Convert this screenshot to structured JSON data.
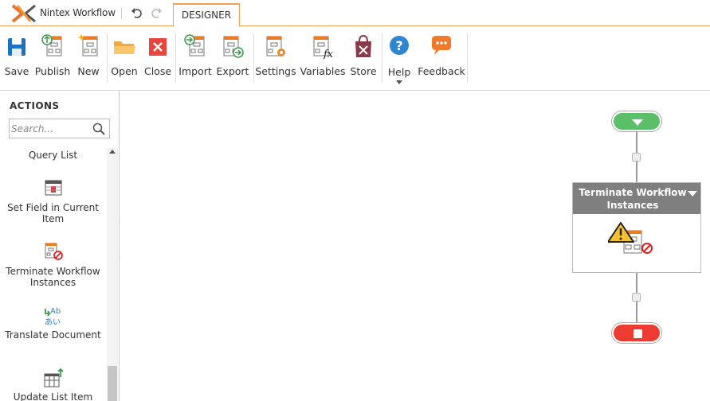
{
  "titlebar": {
    "brand": "Nintex Workflow",
    "tab_designer": "DESIGNER"
  },
  "ribbon": {
    "buttons": [
      {
        "label": "Save",
        "icon": "save-icon"
      },
      {
        "label": "Publish",
        "icon": "publish-icon"
      },
      {
        "label": "New",
        "icon": "new-icon"
      },
      {
        "label": "Open",
        "icon": "folder-icon"
      },
      {
        "label": "Close",
        "icon": "close-icon"
      },
      {
        "label": "Import",
        "icon": "import-icon"
      },
      {
        "label": "Export",
        "icon": "export-icon"
      },
      {
        "label": "Settings",
        "icon": "settings-icon"
      },
      {
        "label": "Variables",
        "icon": "variables-icon"
      },
      {
        "label": "Store",
        "icon": "store-icon"
      },
      {
        "label": "Help",
        "icon": "help-icon"
      },
      {
        "label": "Feedback",
        "icon": "feedback-icon"
      }
    ]
  },
  "actions": {
    "title": "ACTIONS",
    "search_placeholder": "Search...",
    "items": [
      {
        "label": "Query List"
      },
      {
        "label": "Set Field in Current Item"
      },
      {
        "label": "Terminate Workflow Instances"
      },
      {
        "label": "Translate Document"
      },
      {
        "label": "Update List Item"
      }
    ]
  },
  "canvas": {
    "action_title": "Terminate Workflow Instances"
  },
  "colors": {
    "accent_orange": "#f0a050",
    "start_green": "#5cc06a",
    "end_red": "#ee3b32",
    "action_header": "#7f7f7f"
  }
}
